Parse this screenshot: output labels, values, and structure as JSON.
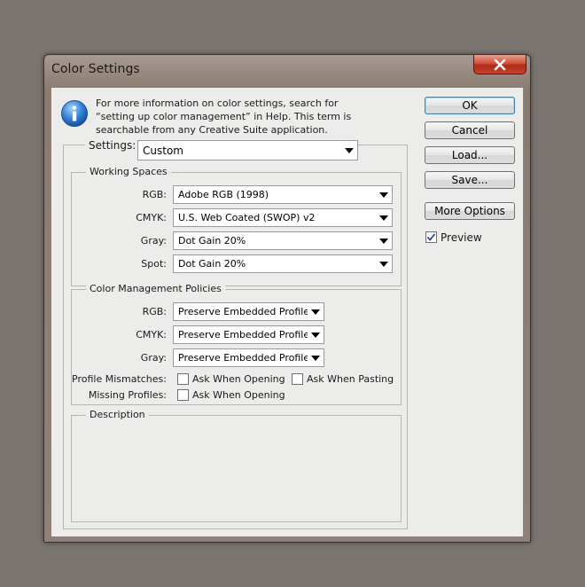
{
  "window": {
    "title": "Color Settings"
  },
  "info": {
    "text": "For more information on color settings, search for “setting up color management” in Help. This term is searchable from any Creative Suite application.",
    "icon": "info-icon"
  },
  "settings": {
    "label": "Settings:",
    "value": "Custom"
  },
  "working_spaces": {
    "legend": "Working Spaces",
    "rows": [
      {
        "label": "RGB:",
        "value": "Adobe RGB (1998)"
      },
      {
        "label": "CMYK:",
        "value": "U.S. Web Coated (SWOP) v2"
      },
      {
        "label": "Gray:",
        "value": "Dot Gain 20%"
      },
      {
        "label": "Spot:",
        "value": "Dot Gain 20%"
      }
    ]
  },
  "policies": {
    "legend": "Color Management Policies",
    "rows": [
      {
        "label": "RGB:",
        "value": "Preserve Embedded Profiles"
      },
      {
        "label": "CMYK:",
        "value": "Preserve Embedded Profiles"
      },
      {
        "label": "Gray:",
        "value": "Preserve Embedded Profiles"
      }
    ],
    "profile_mismatches": {
      "label": "Profile Mismatches:",
      "ask_opening": "Ask When Opening",
      "ask_opening_checked": false,
      "ask_pasting": "Ask When Pasting",
      "ask_pasting_checked": false
    },
    "missing_profiles": {
      "label": "Missing Profiles:",
      "ask_opening": "Ask When Opening",
      "ask_opening_checked": false
    }
  },
  "description": {
    "legend": "Description"
  },
  "buttons": {
    "ok": "OK",
    "cancel": "Cancel",
    "load": "Load...",
    "save": "Save...",
    "more_options": "More Options"
  },
  "preview": {
    "label": "Preview",
    "checked": true
  },
  "colors": {
    "background": "#7b7470",
    "dialog_face": "#ececea",
    "close_button": "#c8442c",
    "default_button_border": "#3c7fb1"
  }
}
